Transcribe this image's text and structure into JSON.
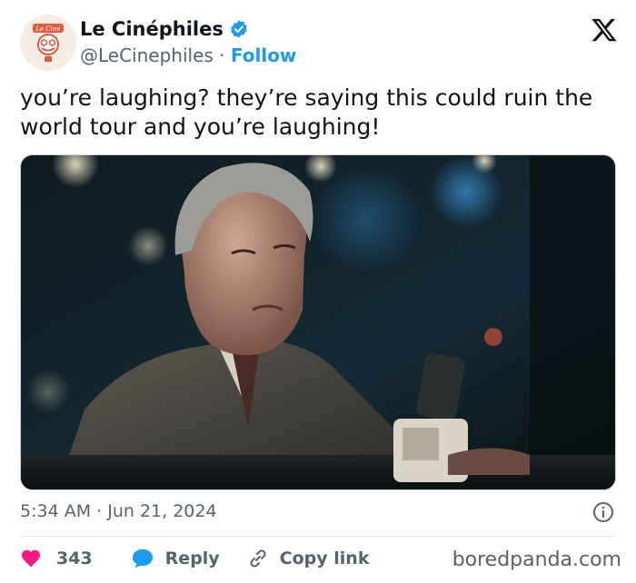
{
  "author": {
    "display_name": "Le Cinéphiles",
    "handle": "@LeCinephiles",
    "separator": " · ",
    "follow_label": "Follow",
    "avatar_logo_text": "Le Ciné"
  },
  "tweet": {
    "text": "you’re laughing? they’re saying this could ruin the world tour and you’re laughing!",
    "timestamp": "5:34 AM · Jun 21, 2024"
  },
  "actions": {
    "like_count": "343",
    "reply_label": "Reply",
    "copy_link_label": "Copy link"
  },
  "watermark": "boredpanda.com",
  "colors": {
    "accent": "#1d9bf0",
    "like": "#f91880",
    "muted": "#536471",
    "text": "#0f1419"
  }
}
